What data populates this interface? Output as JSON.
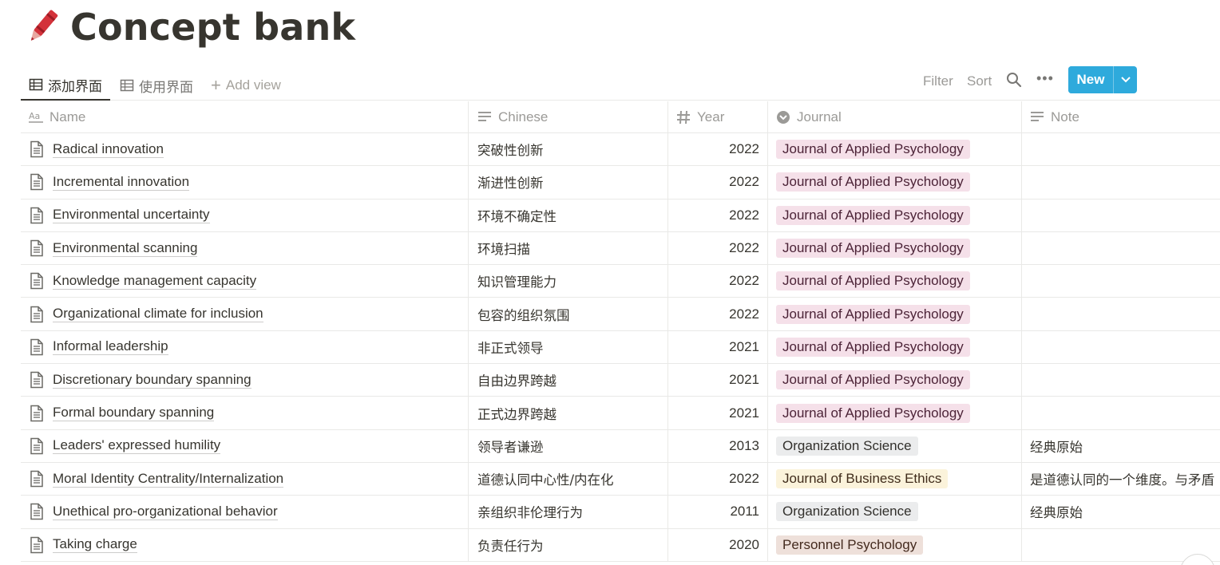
{
  "page": {
    "title": "Concept bank",
    "icon": "crayon-icon"
  },
  "views": {
    "tabs": [
      {
        "label": "添加界面",
        "icon": "table-icon",
        "active": true
      },
      {
        "label": "使用界面",
        "icon": "table-icon",
        "active": false
      }
    ],
    "add_view": "Add view"
  },
  "toolbar": {
    "filter": "Filter",
    "sort": "Sort",
    "search_icon": "search-icon",
    "more": "•••",
    "new_label": "New",
    "new_color": "#2eaadc"
  },
  "table": {
    "columns": [
      {
        "label": "Name",
        "icon": "title-property-icon"
      },
      {
        "label": "Chinese",
        "icon": "text-property-icon"
      },
      {
        "label": "Year",
        "icon": "number-property-icon"
      },
      {
        "label": "Journal",
        "icon": "select-property-icon"
      },
      {
        "label": "Note",
        "icon": "text-property-icon"
      }
    ],
    "rows": [
      {
        "name": "Radical innovation",
        "chinese": "突破性创新",
        "year": "2022",
        "journal": "Journal of Applied Psychology",
        "journal_color": "pink",
        "note": ""
      },
      {
        "name": "Incremental innovation",
        "chinese": "渐进性创新",
        "year": "2022",
        "journal": "Journal of Applied Psychology",
        "journal_color": "pink",
        "note": ""
      },
      {
        "name": "Environmental uncertainty",
        "chinese": "环境不确定性",
        "year": "2022",
        "journal": "Journal of Applied Psychology",
        "journal_color": "pink",
        "note": ""
      },
      {
        "name": "Environmental scanning",
        "chinese": "环境扫描",
        "year": "2022",
        "journal": "Journal of Applied Psychology",
        "journal_color": "pink",
        "note": ""
      },
      {
        "name": "Knowledge management capacity",
        "chinese": "知识管理能力",
        "year": "2022",
        "journal": "Journal of Applied Psychology",
        "journal_color": "pink",
        "note": ""
      },
      {
        "name": "Organizational climate for inclusion",
        "chinese": "包容的组织氛围",
        "year": "2022",
        "journal": "Journal of Applied Psychology",
        "journal_color": "pink",
        "note": ""
      },
      {
        "name": "Informal leadership",
        "chinese": "非正式领导",
        "year": "2021",
        "journal": "Journal of Applied Psychology",
        "journal_color": "pink",
        "note": ""
      },
      {
        "name": "Discretionary boundary spanning",
        "chinese": "自由边界跨越",
        "year": "2021",
        "journal": "Journal of Applied Psychology",
        "journal_color": "pink",
        "note": ""
      },
      {
        "name": "Formal boundary spanning",
        "chinese": "正式边界跨越",
        "year": "2021",
        "journal": "Journal of Applied Psychology",
        "journal_color": "pink",
        "note": ""
      },
      {
        "name": "Leaders' expressed humility",
        "chinese": "领导者谦逊",
        "year": "2013",
        "journal": "Organization Science",
        "journal_color": "gray",
        "note": "经典原始"
      },
      {
        "name": "Moral Identity Centrality/Internalization",
        "chinese": "道德认同中心性/内在化",
        "year": "2022",
        "journal": "Journal of Business Ethics",
        "journal_color": "yellow",
        "note": "是道德认同的一个维度。与矛盾"
      },
      {
        "name": "Unethical pro-organizational behavior",
        "chinese": "亲组织非伦理行为",
        "year": "2011",
        "journal": "Organization Science",
        "journal_color": "gray",
        "note": "经典原始"
      },
      {
        "name": "Taking charge",
        "chinese": "负责任行为",
        "year": "2020",
        "journal": "Personnel Psychology",
        "journal_color": "brown",
        "note": ""
      }
    ]
  }
}
